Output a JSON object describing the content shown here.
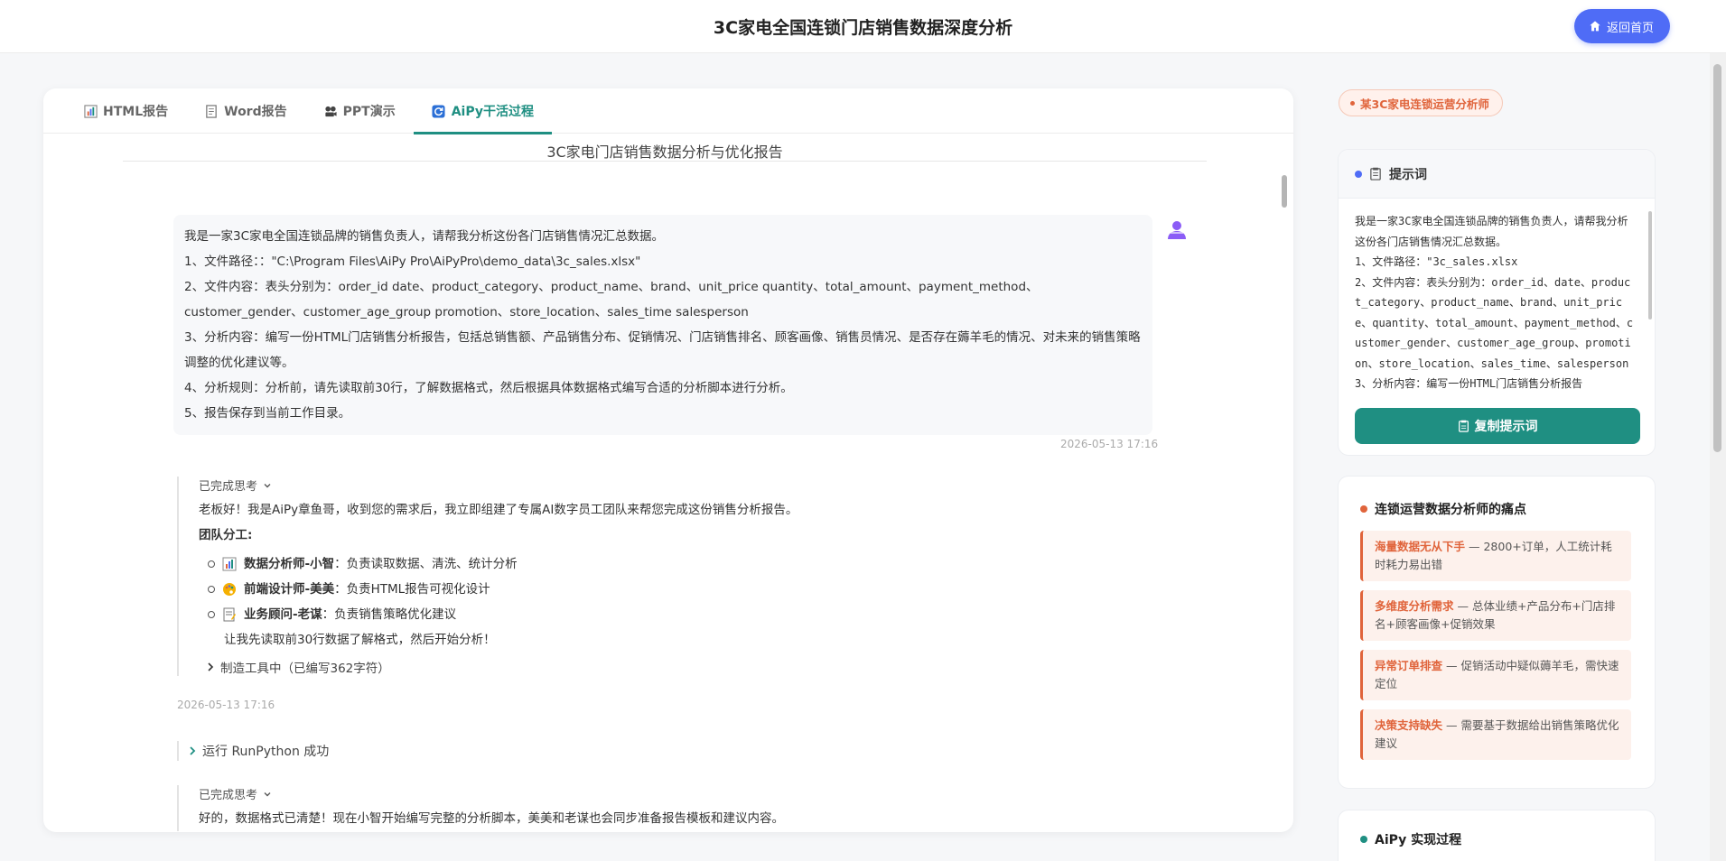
{
  "header": {
    "title": "3C家电全国连锁门店销售数据深度分析",
    "home_label": "返回首页"
  },
  "tabs": [
    {
      "label": "HTML报告",
      "icon": "bar-chart-icon"
    },
    {
      "label": "Word报告",
      "icon": "document-icon"
    },
    {
      "label": "PPT演示",
      "icon": "film-projector-icon"
    },
    {
      "label": "AiPy干活过程",
      "icon": "refresh-icon",
      "active": true
    }
  ],
  "report_title": "3C家电门店销售数据分析与优化报告",
  "user_message": {
    "lines": [
      "我是一家3C家电全国连锁品牌的销售负责人，请帮我分析这份各门店销售情况汇总数据。",
      "1、文件路径：：\"C:\\Program Files\\AiPy Pro\\AiPyPro\\demo_data\\3c_sales.xlsx\"",
      "2、文件内容：表头分别为：order_id date、product_category、product_name、brand、unit_price quantity、total_amount、payment_method、customer_gender、customer_age_group promotion、store_location、sales_time salesperson",
      "3、分析内容：编写一份HTML门店销售分析报告，包括总销售额、产品销售分布、促销情况、门店销售排名、顾客画像、销售员情况、是否存在薅羊毛的情况、对未来的销售策略调整的优化建议等。",
      "4、分析规则：分析前，请先读取前30行，了解数据格式，然后根据具体数据格式编写合适的分析脚本进行分析。",
      "5、报告保存到当前工作目录。"
    ],
    "time": "2026-05-13 17:16"
  },
  "thought1": {
    "head": "已完成思考",
    "intro": "老板好！我是AiPy章鱼哥，收到您的需求后，我立即组建了专属AI数字员工团队来帮您完成这份销售分析报告。",
    "team_label": "团队分工:",
    "members": [
      {
        "name": "数据分析师-小智",
        "desc": "：负责读取数据、清洗、统计分析",
        "icon": "bar-chart-icon"
      },
      {
        "name": "前端设计师-美美",
        "desc": "：负责HTML报告可视化设计",
        "icon": "palette-icon"
      },
      {
        "name": "业务顾问-老谋",
        "desc": "：负责销售策略优化建议",
        "icon": "memo-icon"
      }
    ],
    "note": "让我先读取前30行数据了解格式，然后开始分析！",
    "tool": "制造工具中（已编写362字符）",
    "time": "2026-05-13 17:16"
  },
  "run_status": "运行 RunPython 成功",
  "thought2": {
    "head": "已完成思考",
    "intro": "好的，数据格式已清楚！现在小智开始编写完整的分析脚本，美美和老谋也会同步准备报告模板和建议内容。"
  },
  "sidebar": {
    "role_badge": "某3C家电连锁运营分析师",
    "prompt": {
      "title": "提示词",
      "text": "我是一家3C家电全国连锁品牌的销售负责人，请帮我分析这份各门店销售情况汇总数据。\n1、文件路径：\"3c_sales.xlsx\n2、文件内容：表头分别为：order_id、date、product_category、product_name、brand、unit_price、quantity、total_amount、payment_method、customer_gender、customer_age_group、promotion、store_location、sales_time、salesperson\n3、分析内容：编写一份HTML门店销售分析报告",
      "copy_label": "复制提示词"
    },
    "pain": {
      "title": "连锁运营数据分析师的痛点",
      "items": [
        {
          "hl": "海量数据无从下手",
          "text": " — 2800+订单，人工统计耗时耗力易出错"
        },
        {
          "hl": "多维度分析需求",
          "text": " — 总体业绩+产品分布+门店排名+顾客画像+促销效果"
        },
        {
          "hl": "异常订单排查",
          "text": " — 促销活动中疑似薅羊毛，需快速定位"
        },
        {
          "hl": "决策支持缺失",
          "text": " — 需要基于数据给出销售策略优化建议"
        }
      ]
    },
    "impl_title": "AiPy 实现过程"
  },
  "colors": {
    "accent": "#1f8f82",
    "brand": "#4f6cf6",
    "warning": "#e0643b"
  }
}
